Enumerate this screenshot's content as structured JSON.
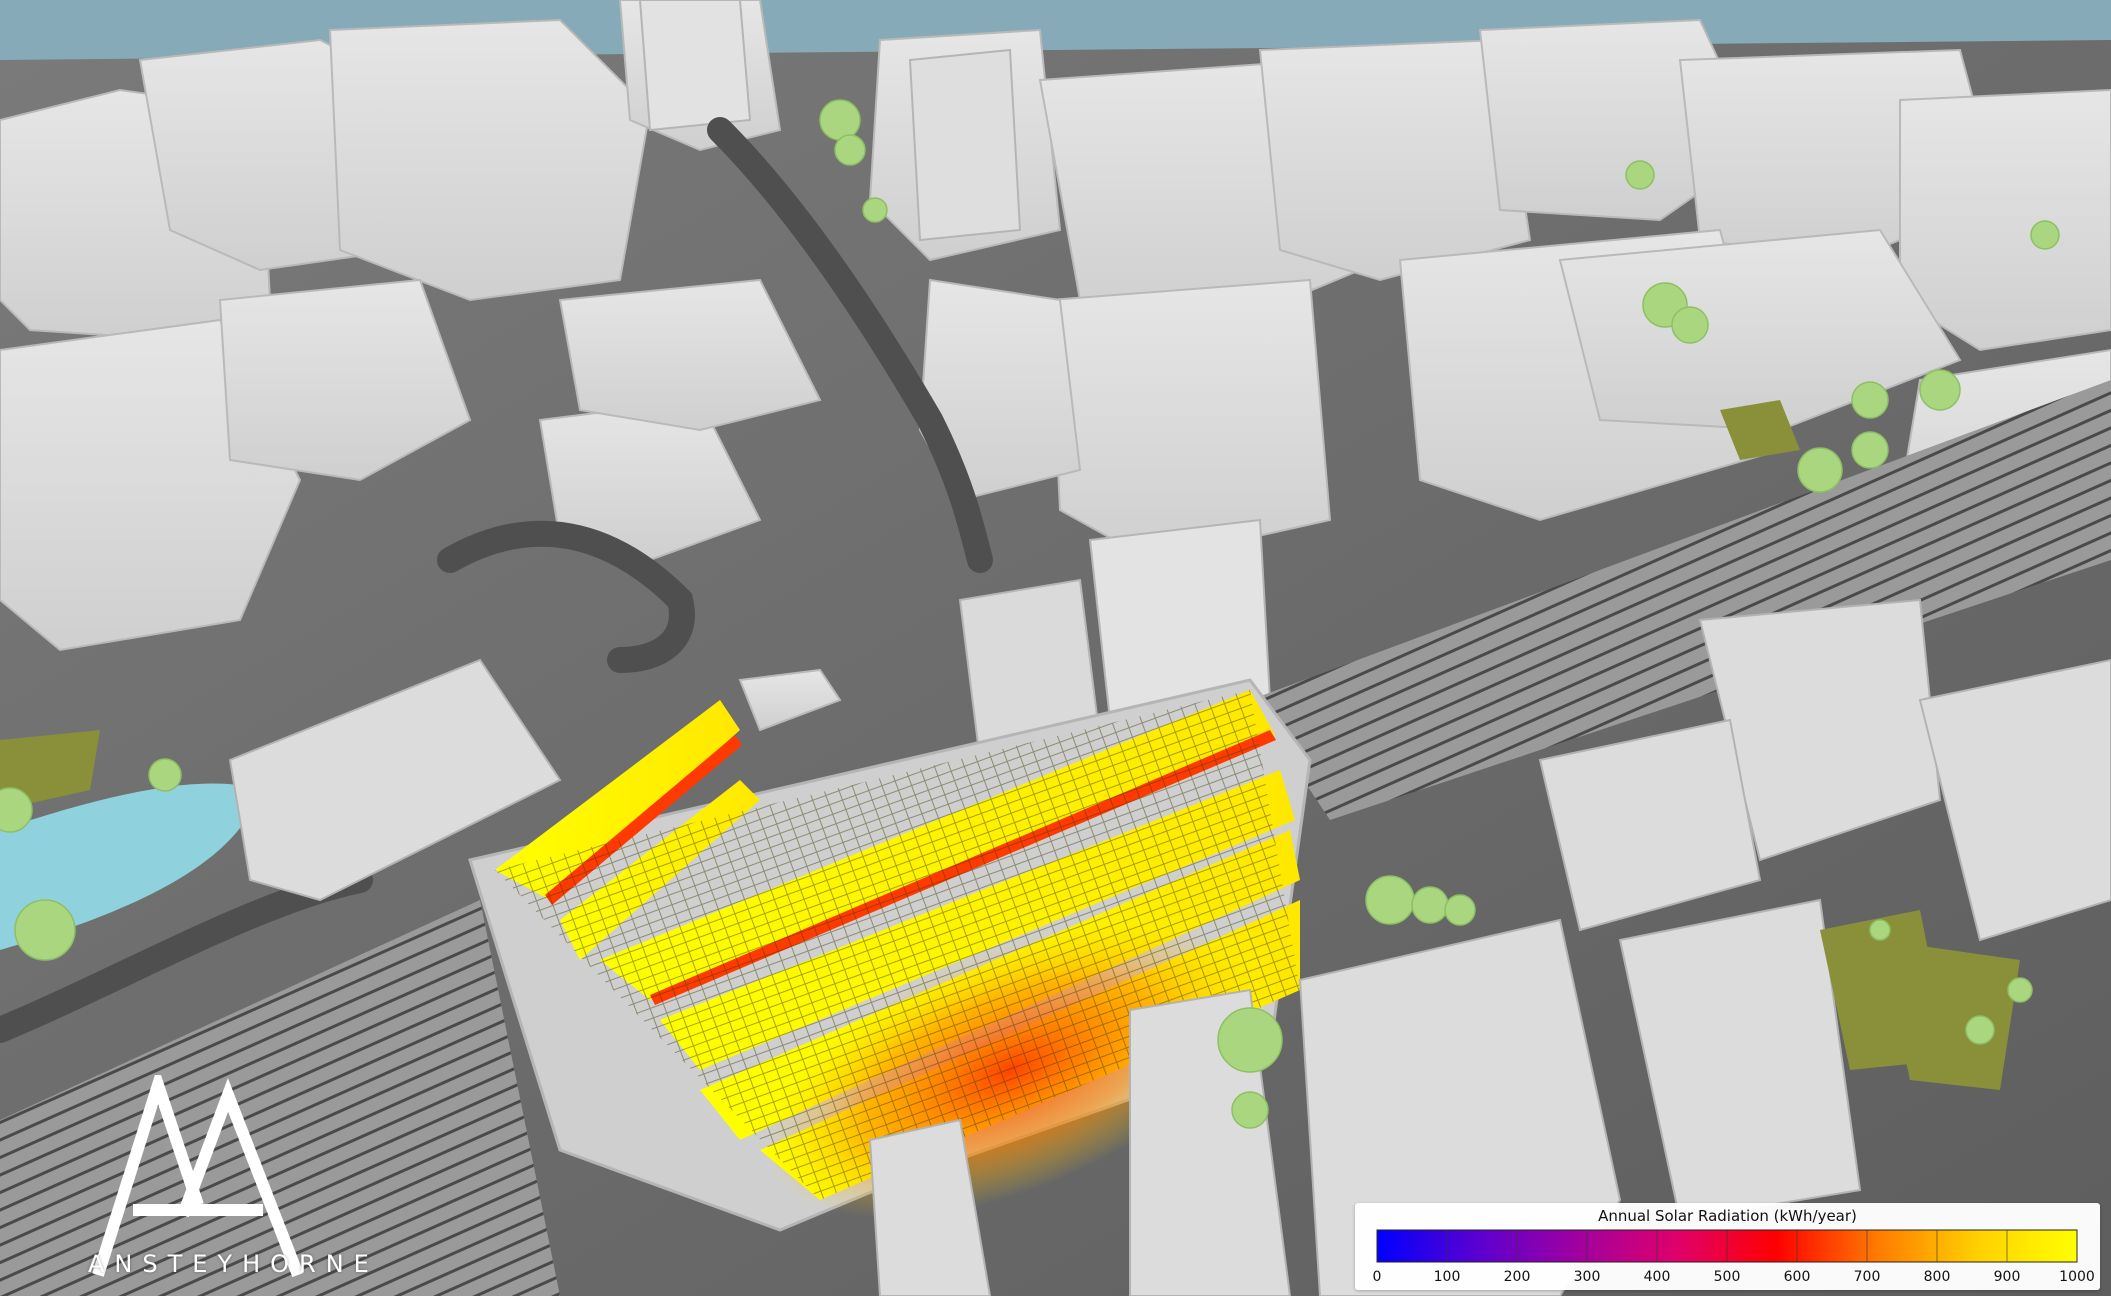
{
  "logo": {
    "wordmark": "ANSTEYHORNE",
    "color": "#ffffff"
  },
  "legend": {
    "title": "Annual Solar Radiation (kWh/year)",
    "min": 0,
    "max": 1000,
    "ticks": [
      "0",
      "100",
      "200",
      "300",
      "400",
      "500",
      "600",
      "700",
      "800",
      "900",
      "1000"
    ],
    "colormap": [
      "#0000ff",
      "#5a00d0",
      "#a000a0",
      "#e0006a",
      "#ff0000",
      "#ff7a00",
      "#ffd000",
      "#ffff00"
    ]
  },
  "scene": {
    "colors": {
      "water": "#86aab7",
      "river": "#8fd2de",
      "ground": "#6d6d6d",
      "building": "#d9d9d9",
      "trees": "#a9d67f",
      "grass": "#8a8f3a",
      "panel_high": "#ffff00",
      "panel_mid": "#ff9a00",
      "panel_low": "#ff2a00"
    }
  }
}
